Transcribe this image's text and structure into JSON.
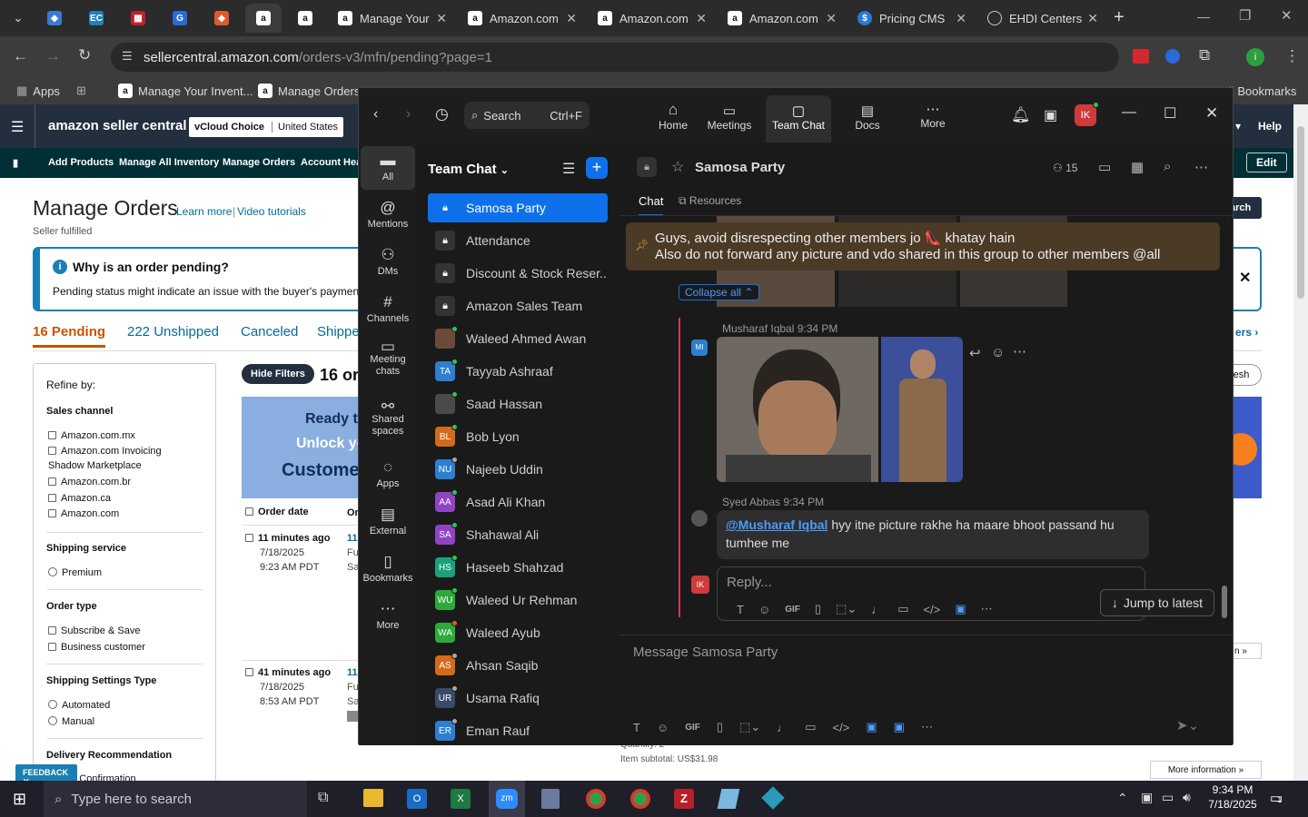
{
  "browser": {
    "tabs": [
      {
        "label": "Manage Your",
        "icon": "amazon-icon"
      },
      {
        "label": "Amazon.com",
        "icon": "amazon-icon"
      },
      {
        "label": "Amazon.com",
        "icon": "amazon-icon"
      },
      {
        "label": "Amazon.com",
        "icon": "amazon-icon"
      },
      {
        "label": "Pricing CMS",
        "icon": "dollar-icon"
      },
      {
        "label": "EHDI Centers",
        "icon": "globe-icon"
      }
    ],
    "url_host": "sellercentral.amazon.com",
    "url_path": "/orders-v3/mfn/pending?page=1",
    "bookmarks": [
      "Apps",
      "Manage Your Invent...",
      "Manage Orders"
    ],
    "all_bookmarks": "All Bookmarks"
  },
  "amazon": {
    "logo": "amazon seller central",
    "store_choice": "vCloud Choice",
    "store_region": "United States",
    "help": "Help",
    "nav": [
      "Add Products",
      "Manage All Inventory",
      "Manage Orders",
      "Account Heal"
    ],
    "edit": "Edit",
    "page_title": "Manage Orders",
    "learn_more": "Learn more",
    "video_tutorials": "Video tutorials",
    "subtitle": "Seller fulfilled",
    "pending_title": "Why is an order pending?",
    "pending_text": "Pending status might indicate an issue with the buyer's payment m",
    "tabs": [
      "16 Pending",
      "222 Unshipped",
      "Canceled",
      "Shippe"
    ],
    "refine_by": "Refine by:",
    "sales_channel_h": "Sales channel",
    "sales_channels": [
      "Amazon.com.mx",
      "Amazon.com Invoicing",
      "Shadow Marketplace",
      "Amazon.com.br",
      "Amazon.ca",
      "Amazon.com"
    ],
    "shipping_service_h": "Shipping service",
    "shipping_service": "Premium",
    "order_type_h": "Order type",
    "order_types": [
      "Subscribe & Save",
      "Business customer"
    ],
    "ship_settings_h": "Shipping Settings Type",
    "ship_settings": [
      "Automated",
      "Manual"
    ],
    "delivery_h": "Delivery Recommendation",
    "delivery_item": "nature Confirmation",
    "hide_filters": "Hide Filters",
    "orders_count": "16 or",
    "banner_lines": [
      "Ready t",
      "Unlock yo",
      "Custome"
    ],
    "col_order_date": "Order date",
    "col_order": "Or",
    "orders": [
      {
        "ago": "11 minutes ago",
        "date": "7/18/2025",
        "time": "9:23 AM PDT",
        "id": "11",
        "s1": "Fu",
        "s2": "Sa"
      },
      {
        "ago": "41 minutes ago",
        "date": "7/18/2025",
        "time": "8:53 AM PDT",
        "id": "11",
        "s1": "Fu",
        "s2": "Sa"
      }
    ],
    "right_search": "arch",
    "right_link": "ers ›",
    "right_refresh": "resh",
    "right_misc": "n »",
    "quantity": "Quantity: 2",
    "item_subtotal": "Item subtotal: US$31.98",
    "more_info": "More information »",
    "feedback": "FEEDBACK"
  },
  "zoom": {
    "search": "Search",
    "search_shortcut": "Ctrl+F",
    "top_nav": [
      {
        "label": "Home",
        "icon": "home-icon"
      },
      {
        "label": "Meetings",
        "icon": "video-icon"
      },
      {
        "label": "Team Chat",
        "icon": "chat-icon"
      },
      {
        "label": "Docs",
        "icon": "docs-icon"
      },
      {
        "label": "More",
        "icon": "more-icon"
      }
    ],
    "user_initials": "IK",
    "rail": [
      {
        "label": "All",
        "icon": "chat-bubble-icon"
      },
      {
        "label": "Mentions",
        "icon": "at-icon"
      },
      {
        "label": "DMs",
        "icon": "people-icon"
      },
      {
        "label": "Channels",
        "icon": "hash-icon"
      },
      {
        "label": "Meeting chats",
        "icon": "meeting-icon"
      },
      {
        "label": "Shared spaces",
        "icon": "share-icon"
      },
      {
        "label": "Apps",
        "icon": "apps-icon"
      },
      {
        "label": "External",
        "icon": "external-icon"
      },
      {
        "label": "Bookmarks",
        "icon": "bookmark-icon"
      },
      {
        "label": "More",
        "icon": "more-icon"
      }
    ],
    "list_title": "Team Chat",
    "channels": [
      {
        "name": "Samosa Party",
        "type": "lock"
      },
      {
        "name": "Attendance",
        "type": "lock"
      },
      {
        "name": "Discount & Stock Reser...",
        "type": "lock"
      },
      {
        "name": "Amazon Sales Team",
        "type": "lock"
      },
      {
        "name": "Waleed Ahmed Awan",
        "initials": "",
        "color": "#6b4a3a",
        "status": "#2ec458"
      },
      {
        "name": "Tayyab Ashraaf",
        "initials": "TA",
        "color": "#2d7fd0",
        "status": "#2ec458"
      },
      {
        "name": "Saad Hassan",
        "initials": "",
        "color": "#4a4a4a",
        "status": "#2ec458"
      },
      {
        "name": "Bob Lyon",
        "initials": "BL",
        "color": "#d46a1c",
        "status": "#2ec458"
      },
      {
        "name": "Najeeb Uddin",
        "initials": "NU",
        "color": "#2d7fd0",
        "status": "#aaaaaa"
      },
      {
        "name": "Asad Ali Khan",
        "initials": "AA",
        "color": "#8e44c4",
        "status": "#2ec458"
      },
      {
        "name": "Shahawal Ali",
        "initials": "SA",
        "color": "#8e44c4",
        "status": "#2ec458"
      },
      {
        "name": "Haseeb Shahzad",
        "initials": "HS",
        "color": "#1aa37a",
        "status": "#2ec458"
      },
      {
        "name": "Waleed Ur Rehman",
        "initials": "WU",
        "color": "#2eaa3c",
        "status": "#2ec458"
      },
      {
        "name": "Waleed Ayub",
        "initials": "WA",
        "color": "#2eaa3c",
        "status": "#e05a2a"
      },
      {
        "name": "Ahsan Saqib",
        "initials": "AS",
        "color": "#d46a1c",
        "status": "#aaaaaa"
      },
      {
        "name": "Usama Rafiq",
        "initials": "UR",
        "color": "#3a4a6a",
        "status": "#aaaaaa"
      },
      {
        "name": "Eman Rauf",
        "initials": "ER",
        "color": "#2d7fd0",
        "status": "#aaaaaa"
      }
    ],
    "chat_title": "Samosa Party",
    "member_count": "15",
    "chat_tabs": [
      "Chat",
      "Resources"
    ],
    "pinned_line1": "Guys, avoid disrespecting other members jo 👠 khatay hain",
    "pinned_line2": "Also do not forward any picture and vdo shared in this group to other members @all",
    "collapse_all": "Collapse all",
    "msg1_author": "Musharaf Iqbal",
    "msg1_time": "9:34 PM",
    "msg1_initials": "MI",
    "msg2_author": "Syed Abbas",
    "msg2_time": "9:34 PM",
    "msg2_mention": "@Musharaf Iqbal",
    "msg2_text_a": " hyy itne picture rakhe ha maare bhoot passand hu",
    "msg2_text_b": "tumhee me",
    "reply_placeholder": "Reply...",
    "jump_latest": "Jump to latest",
    "message_placeholder": "Message Samosa Party",
    "gif": "GIF"
  },
  "taskbar": {
    "search": "Type here to search",
    "time": "9:34 PM",
    "date": "7/18/2025",
    "notif_count": "1"
  }
}
